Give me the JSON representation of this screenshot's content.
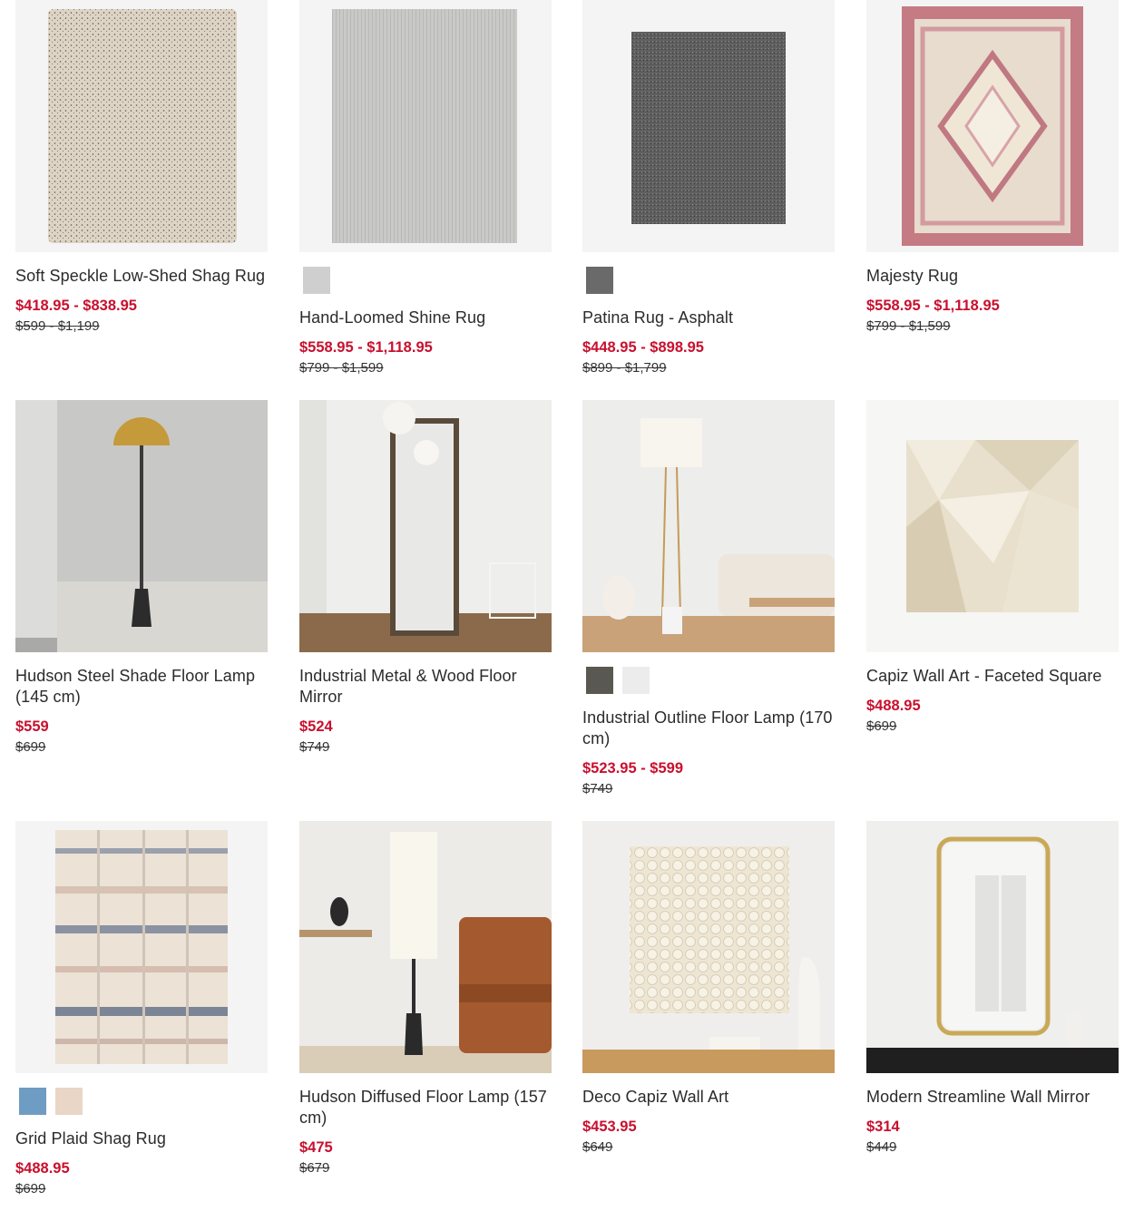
{
  "colors": {
    "sale": "#c8102e",
    "text": "#2b2b2b",
    "image_bg": "#f4f4f4"
  },
  "products": [
    {
      "name": "Soft Speckle Low-Shed Shag Rug",
      "sale_price": "$418.95 - $838.95",
      "original_price": "$599 - $1,199",
      "swatches": [],
      "image": "speckle-rug"
    },
    {
      "name": "Hand-Loomed Shine Rug",
      "sale_price": "$558.95 - $1,118.95",
      "original_price": "$799 - $1,599",
      "swatches": [
        "#cfcfcf"
      ],
      "image": "shine-rug"
    },
    {
      "name": "Patina Rug - Asphalt",
      "sale_price": "$448.95 - $898.95",
      "original_price": "$899 - $1,799",
      "swatches": [
        "#6a6a6a"
      ],
      "image": "patina-rug"
    },
    {
      "name": "Majesty Rug",
      "sale_price": "$558.95 - $1,118.95",
      "original_price": "$799 - $1,599",
      "swatches": [],
      "image": "majesty-rug"
    },
    {
      "name": "Hudson Steel Shade Floor Lamp (145 cm)",
      "sale_price": "$559",
      "original_price": "$699",
      "swatches": [],
      "image": "dome-lamp"
    },
    {
      "name": "Industrial Metal & Wood Floor Mirror",
      "sale_price": "$524",
      "original_price": "$749",
      "swatches": [],
      "image": "floor-mirror"
    },
    {
      "name": "Industrial Outline Floor Lamp (170 cm)",
      "sale_price": "$523.95 - $599",
      "original_price": "$749",
      "swatches": [
        "#5a5853",
        "#ececec"
      ],
      "image": "outline-lamp"
    },
    {
      "name": "Capiz Wall Art - Faceted Square",
      "sale_price": "$488.95",
      "original_price": "$699",
      "swatches": [],
      "image": "capiz-square"
    },
    {
      "name": "Grid Plaid Shag Rug",
      "sale_price": "$488.95",
      "original_price": "$699",
      "swatches": [
        "#6f9cc2",
        "#e9d6c6"
      ],
      "image": "plaid-rug"
    },
    {
      "name": "Hudson Diffused Floor Lamp (157 cm)",
      "sale_price": "$475",
      "original_price": "$679",
      "swatches": [],
      "image": "diffused-lamp"
    },
    {
      "name": "Deco Capiz Wall Art",
      "sale_price": "$453.95",
      "original_price": "$649",
      "swatches": [],
      "image": "deco-capiz"
    },
    {
      "name": "Modern Streamline Wall Mirror",
      "sale_price": "$314",
      "original_price": "$449",
      "swatches": [],
      "image": "wall-mirror"
    }
  ]
}
